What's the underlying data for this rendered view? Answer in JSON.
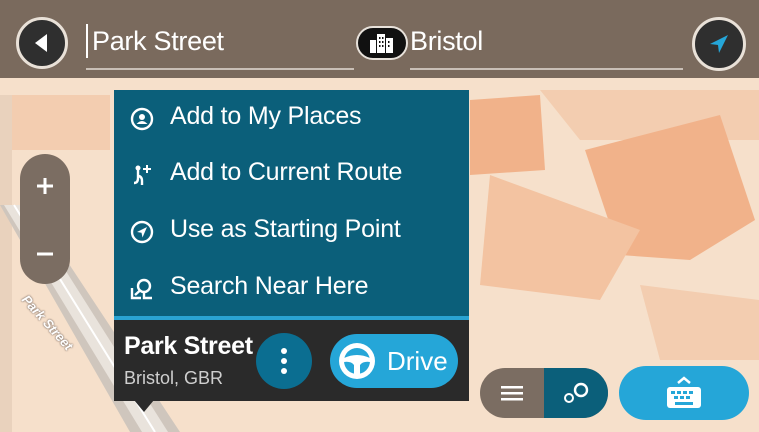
{
  "search": {
    "street_value": "Park Street",
    "city_value": "Bristol"
  },
  "map": {
    "street_label": "Park Street"
  },
  "menu": {
    "items": [
      {
        "label": "Add to My Places",
        "icon": "my-places-icon"
      },
      {
        "label": "Add to Current Route",
        "icon": "add-to-route-icon"
      },
      {
        "label": "Use as Starting Point",
        "icon": "starting-point-icon"
      },
      {
        "label": "Search Near Here",
        "icon": "search-near-icon"
      }
    ]
  },
  "location_card": {
    "title": "Park Street",
    "subtitle": "Bristol, GBR",
    "drive_label": "Drive"
  },
  "colors": {
    "menu_bg": "#0b5f7a",
    "accent_blue": "#25a6d8",
    "top_bar": "#7a6a5d",
    "card_bg": "#2a2a2a"
  }
}
